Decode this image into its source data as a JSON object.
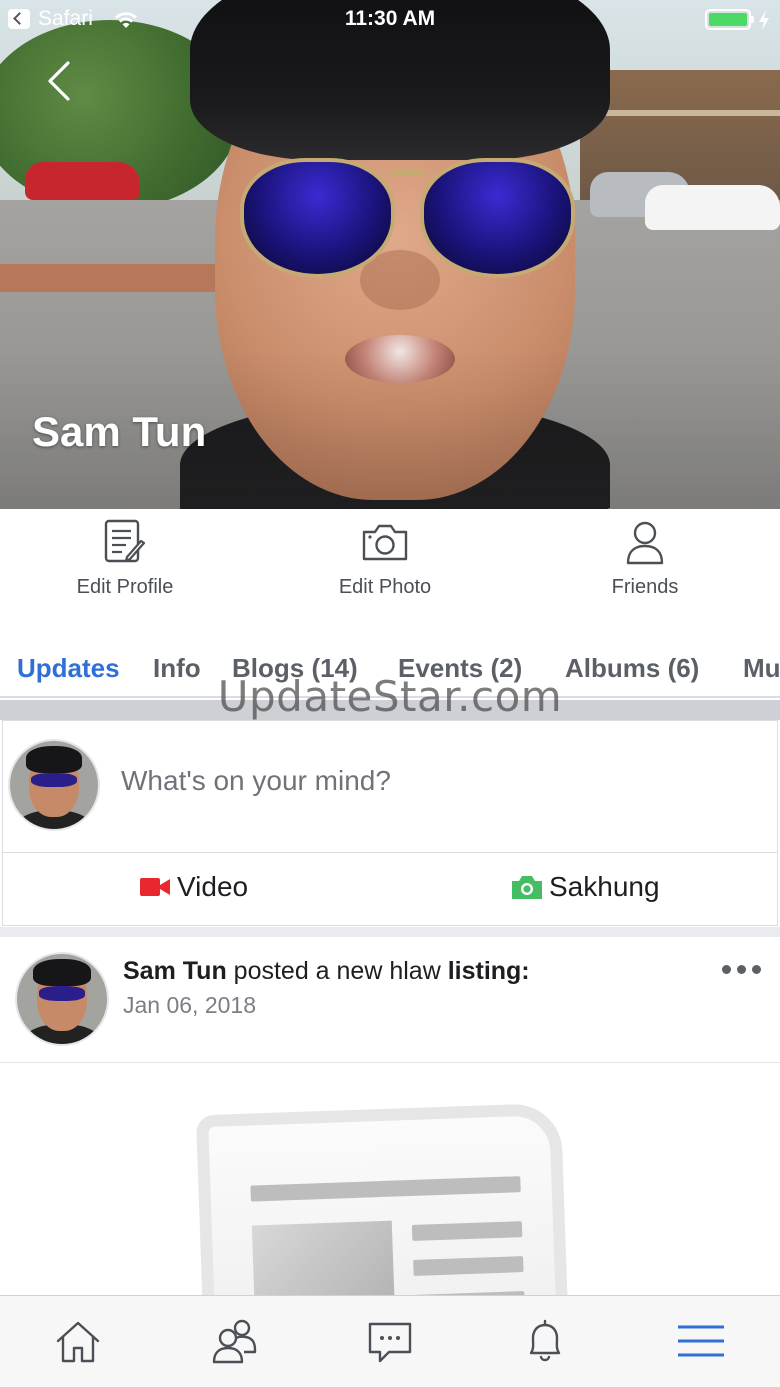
{
  "status_bar": {
    "back_app": "Safari",
    "time": "11:30 AM"
  },
  "profile": {
    "name": "Sam Tun"
  },
  "actions": [
    {
      "label": "Edit Profile",
      "icon": "edit-document-icon"
    },
    {
      "label": "Edit Photo",
      "icon": "camera-icon"
    },
    {
      "label": "Friends",
      "icon": "person-icon"
    }
  ],
  "tabs": [
    {
      "label": "Updates",
      "active": true
    },
    {
      "label": "Info",
      "active": false
    },
    {
      "label": "Blogs (14)",
      "active": false
    },
    {
      "label": "Events (2)",
      "active": false
    },
    {
      "label": "Albums (6)",
      "active": false
    },
    {
      "label": "Mu",
      "active": false
    }
  ],
  "watermark": "UpdateStar.com",
  "composer": {
    "placeholder": "What's on your mind?",
    "video_label": "Video",
    "photo_label": "Sakhung"
  },
  "post": {
    "author": "Sam Tun",
    "action_text": " posted a new hlaw ",
    "object_text": "listing:",
    "date": "Jan 06, 2018"
  },
  "colors": {
    "accent": "#2f6fd6",
    "video_icon": "#e8272f",
    "photo_icon": "#45bd62",
    "battery": "#4cd964"
  },
  "bottom_nav": [
    {
      "name": "home-icon",
      "active": false
    },
    {
      "name": "friends-icon",
      "active": false
    },
    {
      "name": "messages-icon",
      "active": false
    },
    {
      "name": "notifications-icon",
      "active": false
    },
    {
      "name": "menu-icon",
      "active": true
    }
  ]
}
